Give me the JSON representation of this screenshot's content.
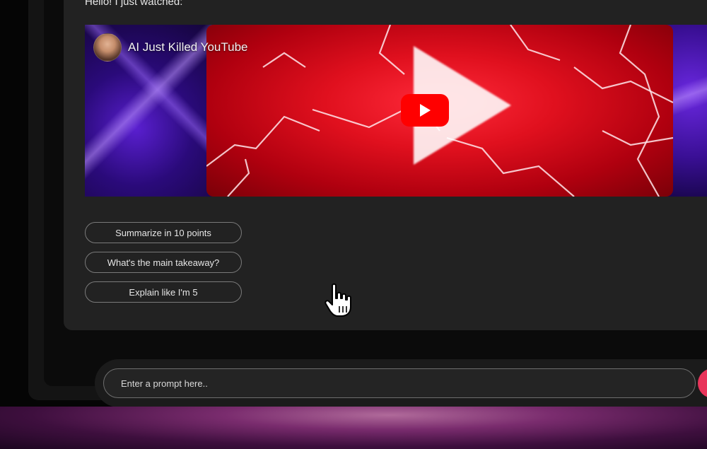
{
  "chat": {
    "greeting": "Hello! I just watched:"
  },
  "video": {
    "title": "AI Just Killed YouTube",
    "play_icon": "youtube-play-icon"
  },
  "suggestions": [
    {
      "label": "Summarize in 10 points"
    },
    {
      "label": "What's the main takeaway?"
    },
    {
      "label": "Explain like I'm 5"
    }
  ],
  "prompt": {
    "placeholder": "Enter a prompt here.."
  },
  "colors": {
    "panel_bg": "#222222",
    "youtube_red": "#ff0000",
    "send_accent": "#e8345a"
  }
}
